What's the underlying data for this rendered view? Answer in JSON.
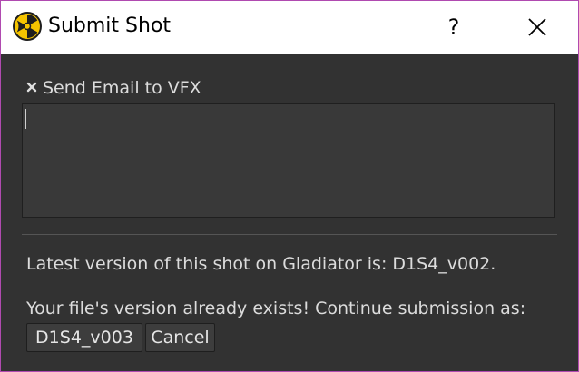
{
  "window": {
    "title": "Submit Shot",
    "help_glyph": "?",
    "icons": {
      "app": "nuke-app-icon",
      "close": "close-icon",
      "checkbox": "checkbox-checked-icon"
    }
  },
  "email": {
    "checkbox_label": "Send Email to VFX",
    "checked": true,
    "body_value": ""
  },
  "info": {
    "latest_version_text": "Latest version of this shot on Gladiator is: D1S4_v002.",
    "exists_text": "Your file's version already exists! Continue submission as:"
  },
  "actions": {
    "version_button_label": "D1S4_v003",
    "cancel_button_label": "Cancel"
  },
  "colors": {
    "accent_border": "#b04ab0",
    "panel_background": "#323232",
    "text": "#dcdcdc",
    "icon_yellow": "#f5c400"
  }
}
